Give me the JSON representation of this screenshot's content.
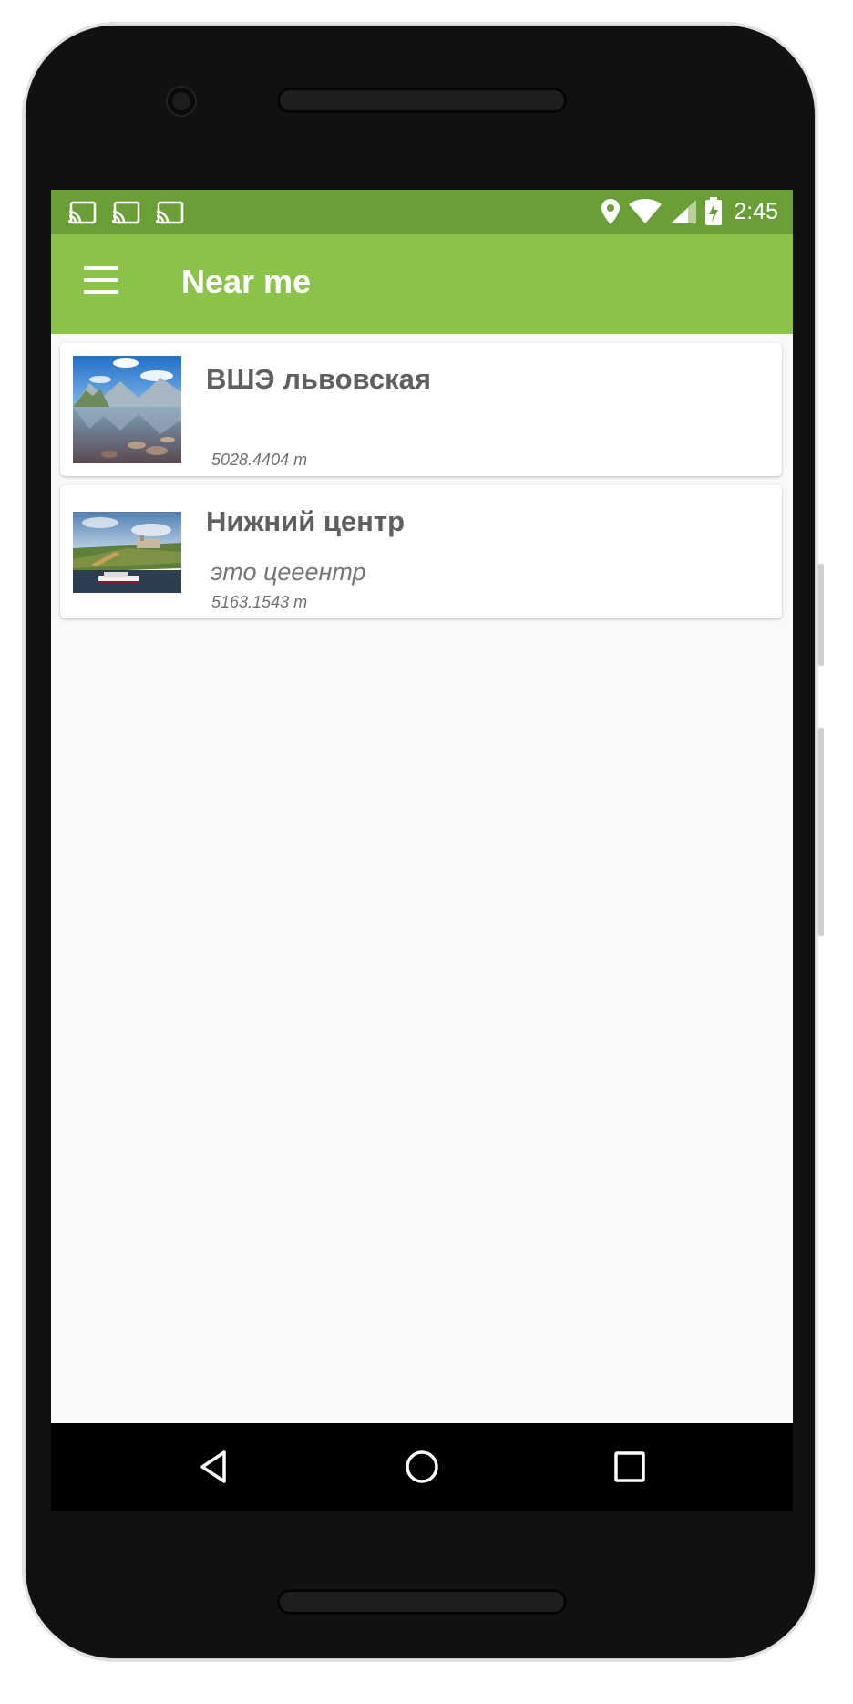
{
  "status_bar": {
    "time": "2:45",
    "icons": [
      "cast-icon",
      "cast-icon",
      "cast-icon",
      "location-icon",
      "wifi-icon",
      "signal-icon",
      "battery-charging-icon"
    ]
  },
  "app_bar": {
    "title": "Near me",
    "menu_icon": "hamburger-menu-icon",
    "color": "#8bc34a",
    "status_color": "#6a9f38"
  },
  "places": [
    {
      "title": "ВШЭ львовская",
      "description": "",
      "distance": "5028.4404 m",
      "thumbnail": "mountain-lake-photo"
    },
    {
      "title": "Нижний центр",
      "description": "это цееентр",
      "distance": "5163.1543 m",
      "thumbnail": "city-riverbank-photo"
    }
  ],
  "nav_bar": {
    "icons": [
      "back-icon",
      "home-icon",
      "recents-icon"
    ]
  }
}
